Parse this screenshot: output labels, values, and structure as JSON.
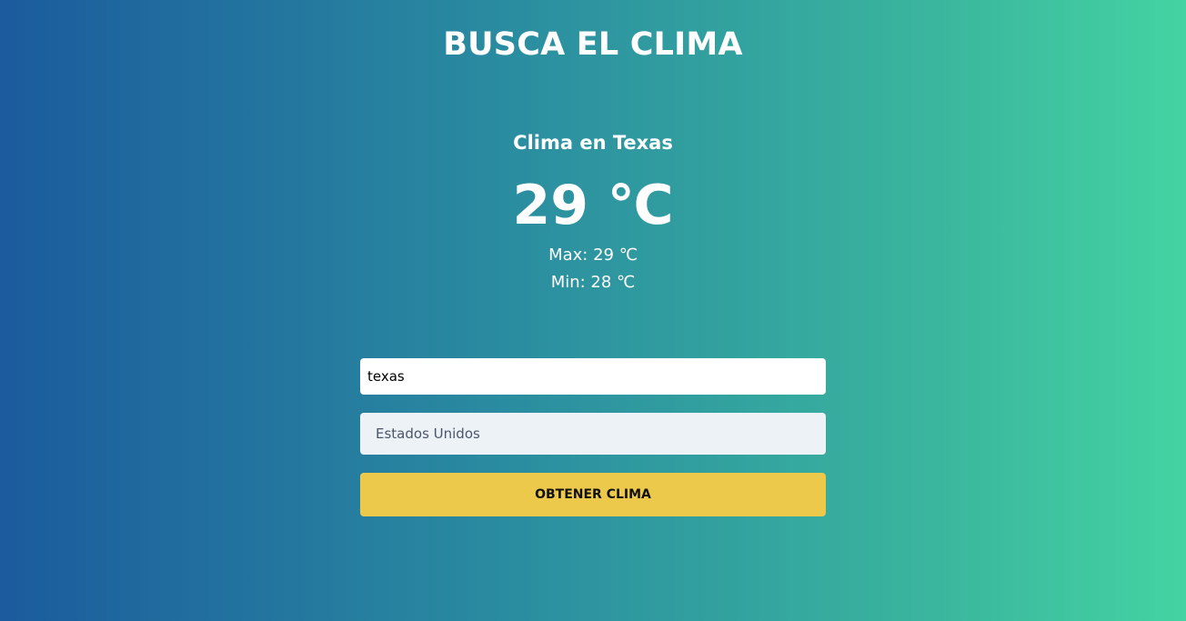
{
  "header": {
    "title": "BUSCA EL CLIMA"
  },
  "weather": {
    "heading": "Clima en Texas",
    "temperature": "29 ℃",
    "max": "Max: 29 ℃",
    "min": "Min: 28 ℃"
  },
  "form": {
    "city_value": "texas",
    "country_selected": "Estados Unidos",
    "submit_label": "OBTENER CLIMA"
  },
  "colors": {
    "gradient_start": "#1b5b9e",
    "gradient_end": "#44d3a2",
    "button": "#ecc94b",
    "select_bg": "#edf2f7"
  }
}
